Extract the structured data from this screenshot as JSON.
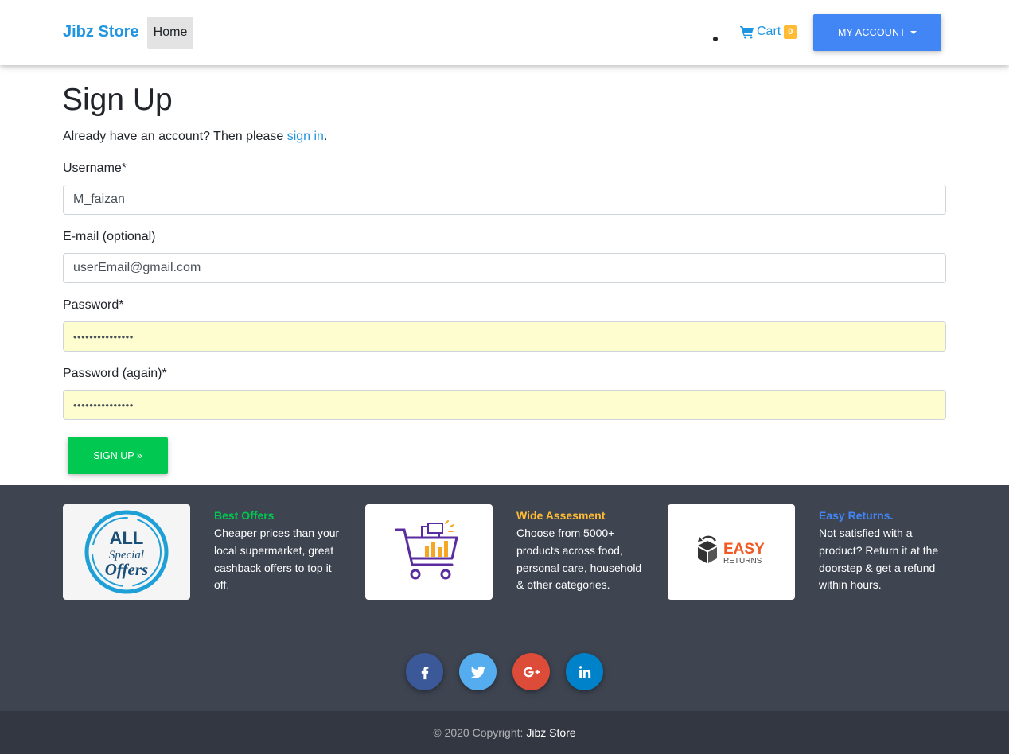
{
  "navbar": {
    "brand": "Jibz Store",
    "home": "Home",
    "cart_label": "Cart",
    "cart_count": "0",
    "account_label": "MY ACCOUNT"
  },
  "page": {
    "title": "Sign Up",
    "intro_prefix": "Already have an account? Then please ",
    "intro_link": "sign in",
    "intro_suffix": "."
  },
  "form": {
    "username_label": "Username*",
    "username_value": "M_faizan",
    "email_label": "E-mail (optional)",
    "email_value": "userEmail@gmail.com",
    "password_label": "Password*",
    "password_value": "•••••••••••••••",
    "password2_label": "Password (again)*",
    "password2_value": "•••••••••••••••",
    "submit_label": "SIGN UP »"
  },
  "features": [
    {
      "title": "Best Offers",
      "description": "Cheaper prices than your local supermarket, great cashback offers to top it off.",
      "color": "#00c851",
      "image": "offers-badge"
    },
    {
      "title": "Wide Assesment",
      "description": "Choose from 5000+ products across food, personal care, household & other categories.",
      "color": "#ffbb33",
      "image": "shopping-cart"
    },
    {
      "title": "Easy Returns.",
      "description": "Not satisfied with a product? Return it at the doorstep & get a refund within hours.",
      "color": "#4285f4",
      "image": "easy-returns"
    }
  ],
  "badge_text": {
    "all": "ALL",
    "special": "Special",
    "offers": "Offers"
  },
  "returns_text": {
    "easy": "EASY",
    "returns": "RETURNS"
  },
  "social": [
    {
      "name": "facebook",
      "color": "#3b5998"
    },
    {
      "name": "twitter",
      "color": "#55acee"
    },
    {
      "name": "google-plus",
      "color": "#dd4b39"
    },
    {
      "name": "linkedin",
      "color": "#0082ca"
    }
  ],
  "footer": {
    "copyright": "© 2020 Copyright:",
    "store": "Jibz Store"
  }
}
